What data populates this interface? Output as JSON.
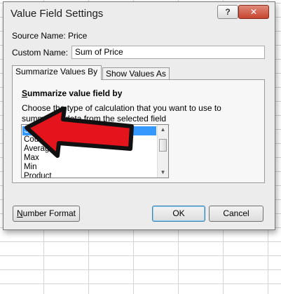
{
  "dialog": {
    "title": "Value Field Settings",
    "help_label": "?",
    "close_label": "✕",
    "source_name_label": "Source Name:",
    "source_name_value": "Price",
    "custom_name_label": "Custom Name:",
    "custom_name_value": "Sum of Price"
  },
  "tabs": [
    {
      "label": "Summarize Values By",
      "active": true
    },
    {
      "label": "Show Values As",
      "active": false
    }
  ],
  "panel": {
    "section_title_first": "S",
    "section_title_rest": "ummarize value field by",
    "description": "Choose the type of calculation that you want to use to summarize data from the selected field"
  },
  "list": {
    "items": [
      "Sum",
      "Count",
      "Average",
      "Max",
      "Min",
      "Product"
    ],
    "selected": "Sum",
    "scroll_up_icon": "triangle-up",
    "scroll_down_icon": "triangle-down"
  },
  "buttons": {
    "number_format_first": "N",
    "number_format_rest": "umber Format",
    "ok": "OK",
    "cancel": "Cancel"
  },
  "colors": {
    "selection": "#3399ff",
    "arrow_fill": "#e3141b",
    "arrow_stroke": "#111111"
  }
}
